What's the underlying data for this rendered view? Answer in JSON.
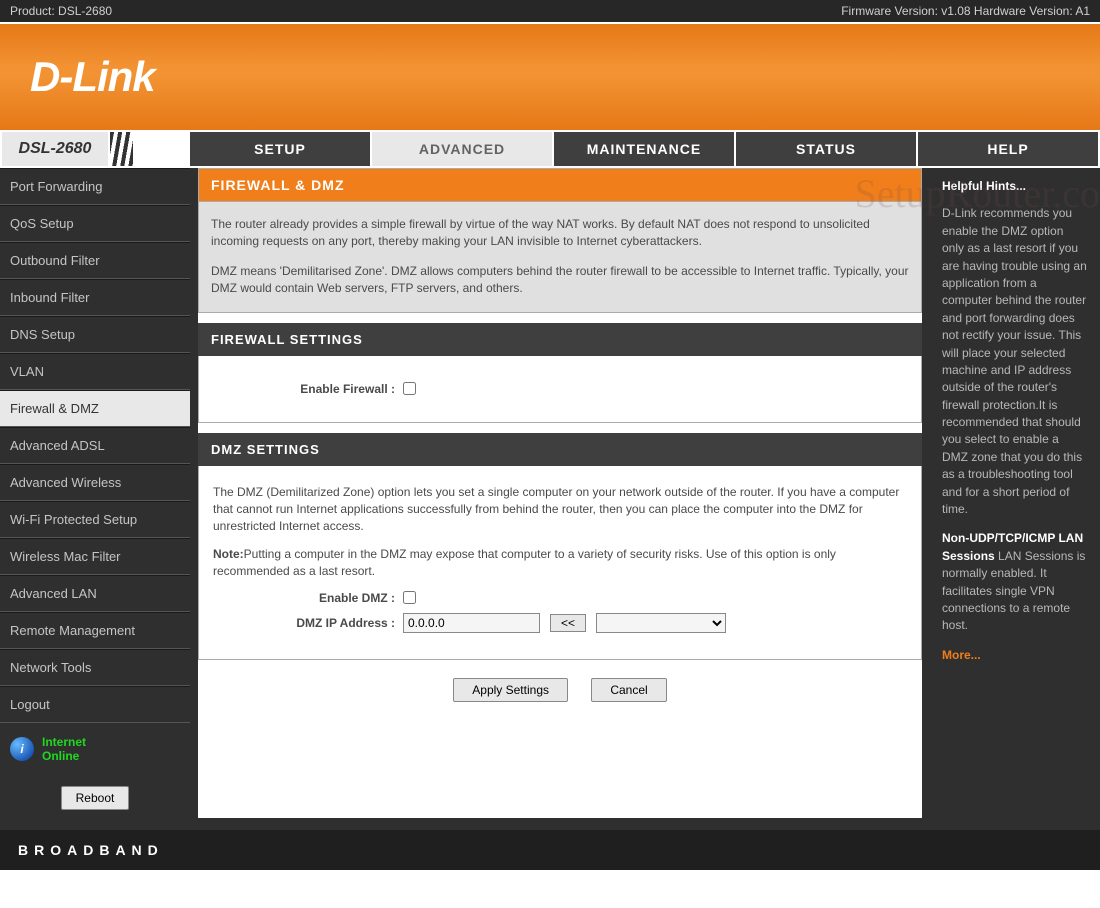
{
  "topbar": {
    "product_label": "Product: DSL-2680",
    "version_label": "Firmware Version: v1.08 Hardware Version: A1"
  },
  "banner": {
    "logo": "D-Link"
  },
  "nav": {
    "model": "DSL-2680",
    "tabs": [
      "SETUP",
      "ADVANCED",
      "MAINTENANCE",
      "STATUS",
      "HELP"
    ],
    "active": "ADVANCED"
  },
  "sidebar": {
    "items": [
      {
        "label": "Port Forwarding",
        "active": false
      },
      {
        "label": "QoS Setup",
        "active": false
      },
      {
        "label": "Outbound Filter",
        "active": false
      },
      {
        "label": "Inbound Filter",
        "active": false
      },
      {
        "label": "DNS Setup",
        "active": false
      },
      {
        "label": "VLAN",
        "active": false
      },
      {
        "label": "Firewall & DMZ",
        "active": true
      },
      {
        "label": "Advanced ADSL",
        "active": false
      },
      {
        "label": "Advanced Wireless",
        "active": false
      },
      {
        "label": "Wi-Fi Protected Setup",
        "active": false
      },
      {
        "label": "Wireless Mac Filter",
        "active": false
      },
      {
        "label": "Advanced LAN",
        "active": false
      },
      {
        "label": "Remote Management",
        "active": false
      },
      {
        "label": "Network Tools",
        "active": false
      },
      {
        "label": "Logout",
        "active": false
      }
    ],
    "status_line1": "Internet",
    "status_line2": "Online",
    "reboot": "Reboot"
  },
  "main": {
    "title": "FIREWALL & DMZ",
    "intro_p1": "The router already provides a simple firewall by virtue of the way NAT works. By default NAT does not respond to unsolicited incoming requests on any port, thereby making your LAN invisible to Internet cyberattackers.",
    "intro_p2": "DMZ means 'Demilitarised Zone'. DMZ allows computers behind the router firewall to be accessible to Internet traffic. Typically, your DMZ would contain Web servers, FTP servers, and others.",
    "fw_title": "FIREWALL SETTINGS",
    "fw_enable_label": "Enable Firewall :",
    "dmz_title": "DMZ SETTINGS",
    "dmz_p1": "The DMZ (Demilitarized Zone) option lets you set a single computer on your network outside of the router. If you have a computer that cannot run Internet applications successfully from behind the router, then you can place the computer into the DMZ for unrestricted Internet access.",
    "dmz_note_label": "Note:",
    "dmz_note_text": "Putting a computer in the DMZ may expose that computer to a variety of security risks. Use of this option is only recommended as a last resort.",
    "dmz_enable_label": "Enable DMZ :",
    "dmz_ip_label": "DMZ IP Address :",
    "dmz_ip_value": "0.0.0.0",
    "arrow_label": "<<",
    "apply_label": "Apply Settings",
    "cancel_label": "Cancel"
  },
  "hints": {
    "title": "Helpful Hints...",
    "p1": "D-Link recommends you enable the DMZ option only as a last resort if you are having trouble using an application from a computer behind the router and port forwarding does not rectify your issue. This will place your selected machine and IP address outside of the router's firewall protection.It is recommended that should you select to enable a DMZ zone that you do this as a troubleshooting tool and for a short period of time.",
    "p2_strong": "Non-UDP/TCP/ICMP LAN Sessions",
    "p2_rest": " LAN Sessions is normally enabled. It facilitates single VPN connections to a remote host.",
    "more": "More..."
  },
  "footer": {
    "text": "BROADBAND"
  },
  "watermark": "SetupRouter.co"
}
